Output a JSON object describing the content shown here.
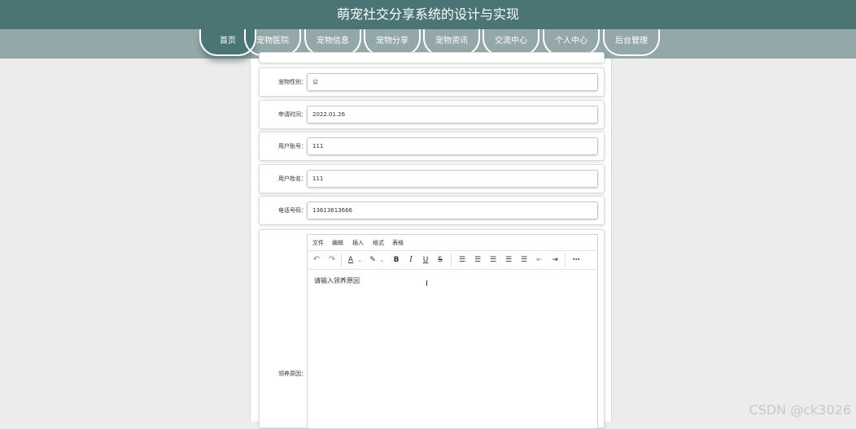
{
  "header": {
    "title": "萌宠社交分享系统的设计与实现"
  },
  "nav": {
    "items": [
      {
        "label": "首页",
        "active": true
      },
      {
        "label": "宠物医院",
        "active": false
      },
      {
        "label": "宠物信息",
        "active": false
      },
      {
        "label": "宠物分享",
        "active": false
      },
      {
        "label": "宠物资讯",
        "active": false
      },
      {
        "label": "交流中心",
        "active": false
      },
      {
        "label": "个人中心",
        "active": false
      },
      {
        "label": "后台管理",
        "active": false
      }
    ]
  },
  "form": {
    "fields": [
      {
        "label": "宠物性别：",
        "value": "公"
      },
      {
        "label": "申请时间：",
        "value": "2022.01.26"
      },
      {
        "label": "用户账号：",
        "value": "111"
      },
      {
        "label": "用户姓名：",
        "value": "111"
      },
      {
        "label": "电话号码：",
        "value": "13613613666"
      }
    ],
    "reason": {
      "label": "领养原因：",
      "menus": [
        "文件",
        "编辑",
        "插入",
        "格式",
        "表格"
      ],
      "placeholder": "请输入领养原因"
    }
  },
  "toolbar_icons": [
    "undo-icon",
    "redo-icon",
    "font-color-icon",
    "highlight-icon",
    "bold-icon",
    "italic-icon",
    "underline-icon",
    "strikethrough-icon",
    "bullet-list-icon",
    "align-left-icon",
    "align-center-icon",
    "align-right-icon",
    "align-justify-icon",
    "outdent-icon",
    "indent-icon",
    "more-icon"
  ],
  "watermark": "CSDN @ck3026",
  "colors": {
    "header": "#4b7575",
    "navbar": "#94a8a9",
    "background": "#ececec"
  }
}
